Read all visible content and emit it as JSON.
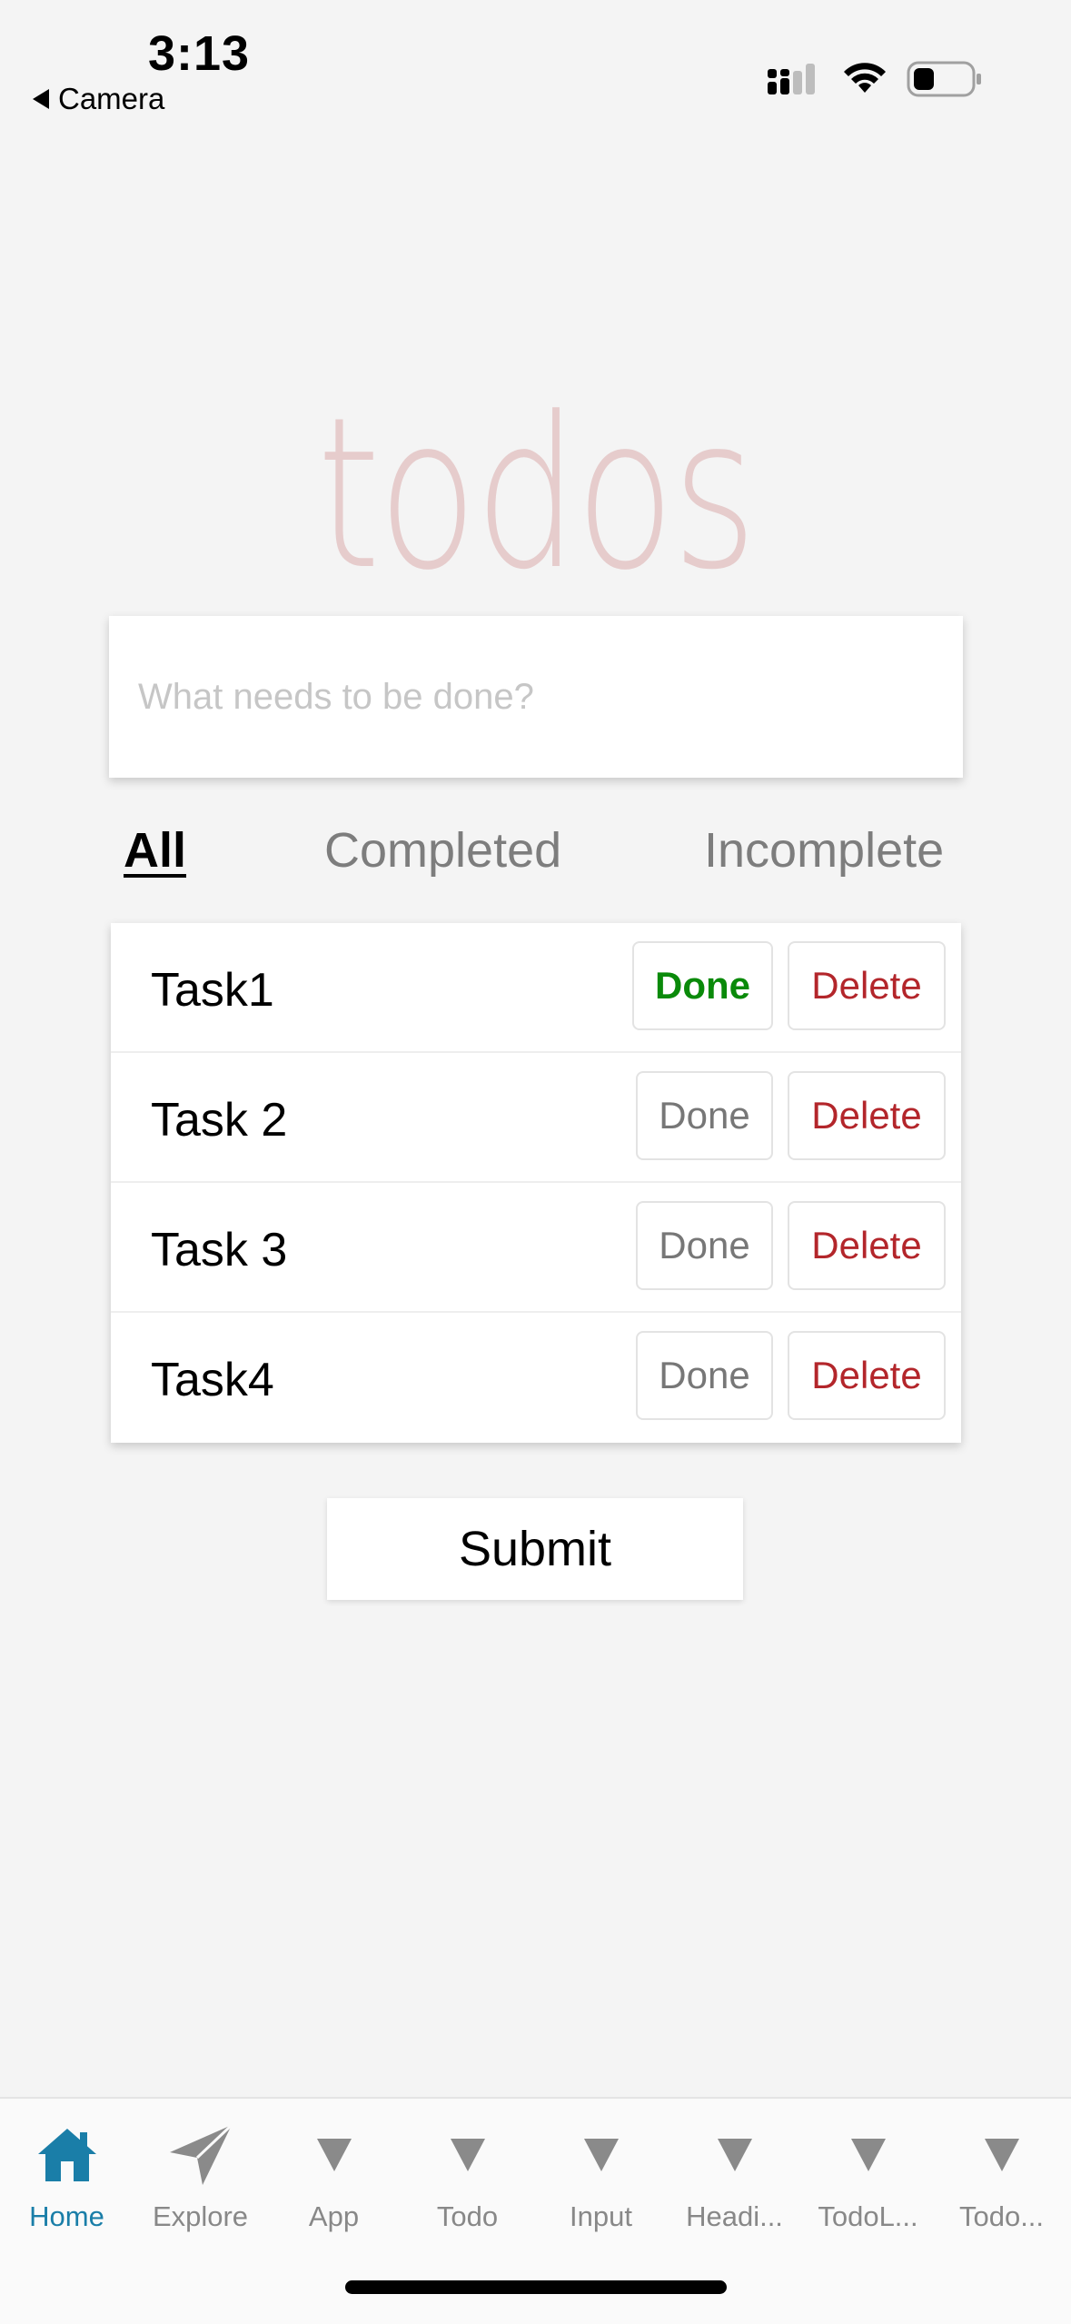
{
  "status_bar": {
    "time": "3:13",
    "back_label": "Camera"
  },
  "app": {
    "title": "todos",
    "input_placeholder": "What needs to be done?",
    "filters": [
      {
        "label": "All",
        "active": true
      },
      {
        "label": "Completed",
        "active": false
      },
      {
        "label": "Incomplete",
        "active": false
      }
    ],
    "tasks": [
      {
        "name": "Task1",
        "done_label": "Done",
        "delete_label": "Delete",
        "completed": true
      },
      {
        "name": "Task 2",
        "done_label": "Done",
        "delete_label": "Delete",
        "completed": false
      },
      {
        "name": "Task 3",
        "done_label": "Done",
        "delete_label": "Delete",
        "completed": false
      },
      {
        "name": "Task4",
        "done_label": "Done",
        "delete_label": "Delete",
        "completed": false
      }
    ],
    "submit_label": "Submit"
  },
  "tab_bar": {
    "items": [
      {
        "label": "Home",
        "icon": "home-icon",
        "active": true
      },
      {
        "label": "Explore",
        "icon": "paper-plane-icon",
        "active": false
      },
      {
        "label": "App",
        "icon": "triangle-icon",
        "active": false
      },
      {
        "label": "Todo",
        "icon": "triangle-icon",
        "active": false
      },
      {
        "label": "Input",
        "icon": "triangle-icon",
        "active": false
      },
      {
        "label": "Headi...",
        "icon": "triangle-icon",
        "active": false
      },
      {
        "label": "TodoL...",
        "icon": "triangle-icon",
        "active": false
      },
      {
        "label": "Todo...",
        "icon": "triangle-icon",
        "active": false
      }
    ]
  },
  "colors": {
    "background": "#f4f4f4",
    "title": "#e6cccc",
    "done_active": "#0a8a0a",
    "delete": "#b3262b",
    "tab_active": "#1a7ea8",
    "tab_inactive": "#888888"
  }
}
